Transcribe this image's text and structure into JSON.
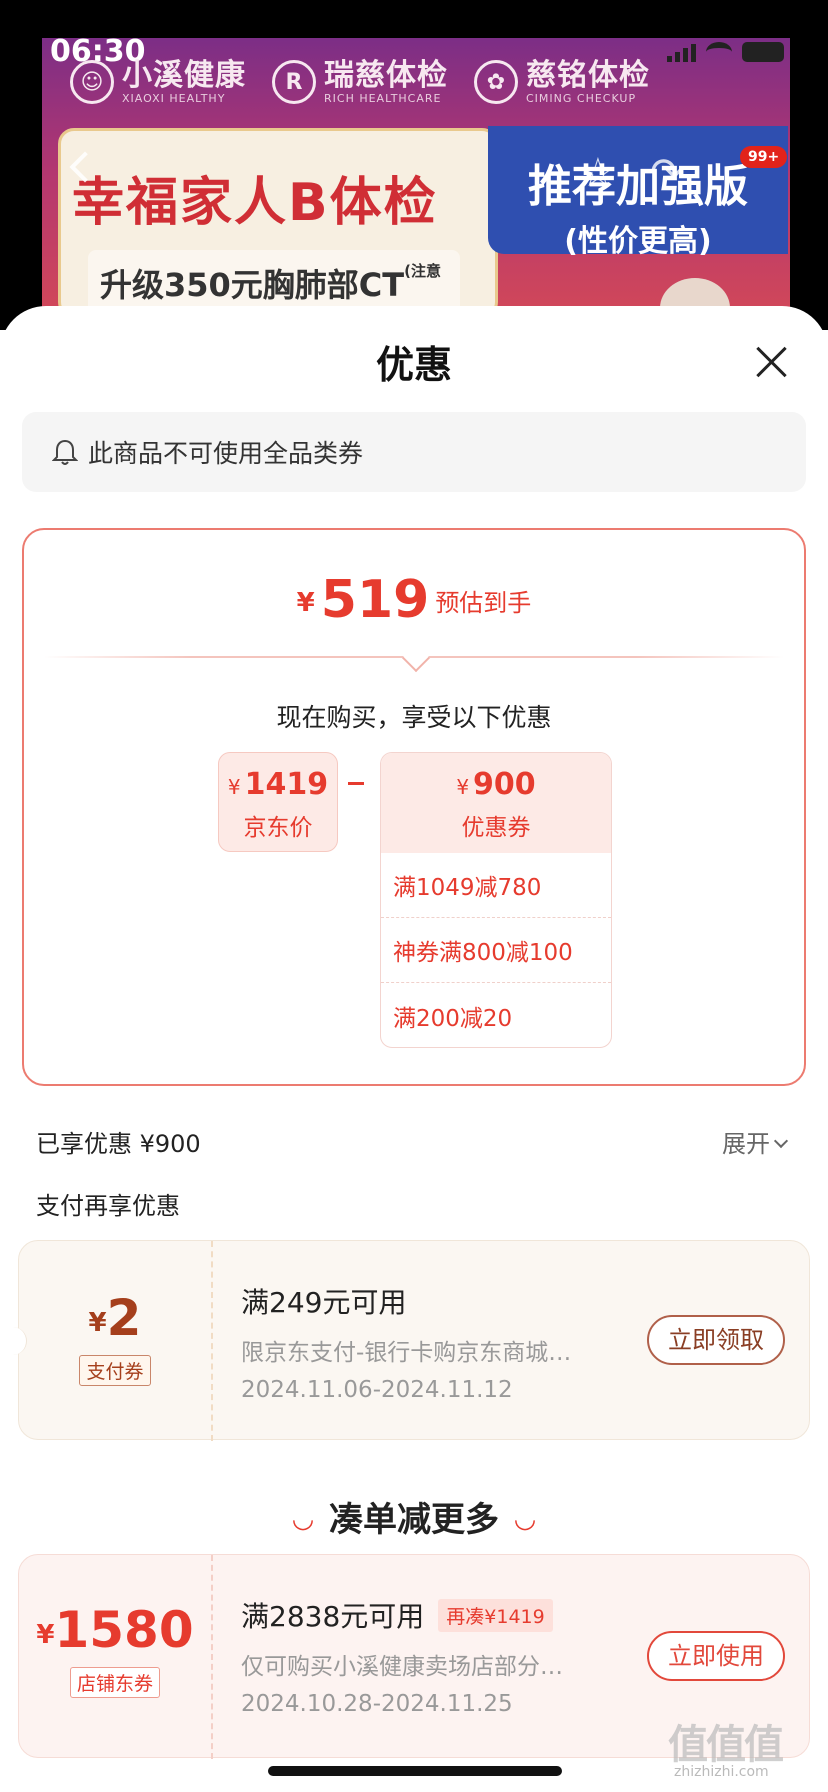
{
  "status_bar": {
    "time": "06:30"
  },
  "background": {
    "brands": [
      {
        "cn": "小溪健康",
        "en": "XIAOXI HEALTHY",
        "logo": ""
      },
      {
        "cn": "瑞慈体检",
        "en": "RICH HEALTHCARE",
        "logo": "R"
      },
      {
        "cn": "慈铭体检",
        "en": "CIMING CHECKUP",
        "logo": ""
      }
    ],
    "product_title": "幸福家人B体检",
    "product_sub": "升级350元胸肺部CT",
    "product_sub_note": "(注意选项)",
    "promo_line1": "推荐加强版",
    "promo_line2": "(性价更高)",
    "badge": "99+"
  },
  "sheet": {
    "title": "优惠",
    "notice": "此商品不可使用全品类券",
    "estimate": {
      "yen": "¥",
      "price": "519",
      "label": "预估到手"
    },
    "buy_now": "现在购买，享受以下优惠",
    "jd_price": {
      "yen": "¥",
      "value": "1419",
      "label": "京东价"
    },
    "coupon_total": {
      "yen": "¥",
      "value": "900",
      "label": "优惠券"
    },
    "coupon_items": [
      "满1049减780",
      "神券满800减100",
      "满200减20"
    ],
    "enjoyed": "已享优惠 ¥900",
    "expand": "展开",
    "pay_more": "支付再享优惠",
    "pay_coupon": {
      "yen": "¥",
      "amount": "2",
      "tag": "支付券",
      "condition": "满249元可用",
      "desc": "限京东支付-银行卡购京东商城…",
      "date": "2024.11.06-2024.11.12",
      "button": "立即领取"
    },
    "more_title": "凑单减更多",
    "shop_coupon": {
      "yen": "¥",
      "amount": "1580",
      "tag": "店铺东券",
      "condition": "满2838元可用",
      "extra": "再凑¥1419",
      "desc": "仅可购买小溪健康卖场店部分…",
      "date": "2024.10.28-2024.11.25",
      "button": "立即使用"
    }
  },
  "watermark": {
    "text": "值值值",
    "url": "zhizhizhi.com"
  },
  "colors": {
    "accent": "#e63b2e",
    "pay_brown": "#a53f1c"
  }
}
